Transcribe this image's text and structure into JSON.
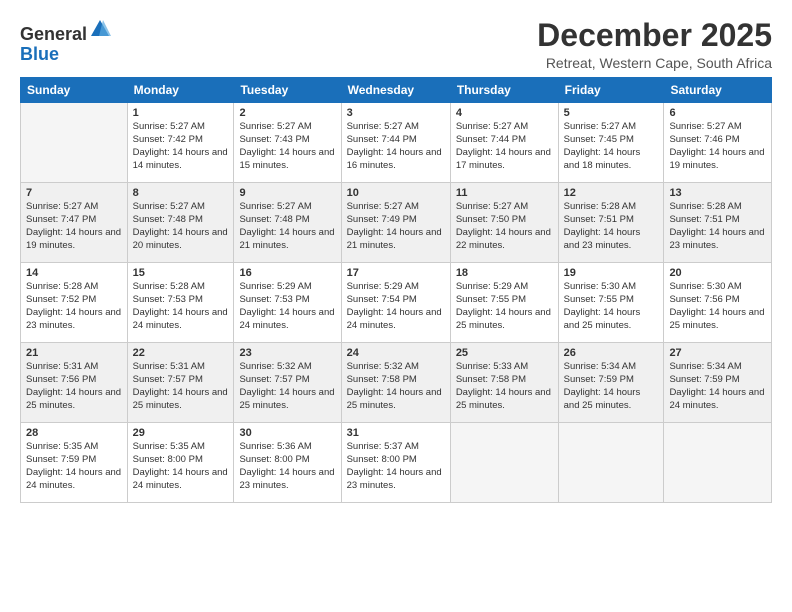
{
  "logo": {
    "line1": "General",
    "line2": "Blue"
  },
  "header": {
    "month": "December 2025",
    "location": "Retreat, Western Cape, South Africa"
  },
  "weekdays": [
    "Sunday",
    "Monday",
    "Tuesday",
    "Wednesday",
    "Thursday",
    "Friday",
    "Saturday"
  ],
  "weeks": [
    [
      {
        "day": "",
        "empty": true
      },
      {
        "day": "1",
        "sunrise": "5:27 AM",
        "sunset": "7:42 PM",
        "daylight": "14 hours and 14 minutes."
      },
      {
        "day": "2",
        "sunrise": "5:27 AM",
        "sunset": "7:43 PM",
        "daylight": "14 hours and 15 minutes."
      },
      {
        "day": "3",
        "sunrise": "5:27 AM",
        "sunset": "7:44 PM",
        "daylight": "14 hours and 16 minutes."
      },
      {
        "day": "4",
        "sunrise": "5:27 AM",
        "sunset": "7:44 PM",
        "daylight": "14 hours and 17 minutes."
      },
      {
        "day": "5",
        "sunrise": "5:27 AM",
        "sunset": "7:45 PM",
        "daylight": "14 hours and 18 minutes."
      },
      {
        "day": "6",
        "sunrise": "5:27 AM",
        "sunset": "7:46 PM",
        "daylight": "14 hours and 19 minutes."
      }
    ],
    [
      {
        "day": "7",
        "sunrise": "5:27 AM",
        "sunset": "7:47 PM",
        "daylight": "14 hours and 19 minutes."
      },
      {
        "day": "8",
        "sunrise": "5:27 AM",
        "sunset": "7:48 PM",
        "daylight": "14 hours and 20 minutes."
      },
      {
        "day": "9",
        "sunrise": "5:27 AM",
        "sunset": "7:48 PM",
        "daylight": "14 hours and 21 minutes."
      },
      {
        "day": "10",
        "sunrise": "5:27 AM",
        "sunset": "7:49 PM",
        "daylight": "14 hours and 21 minutes."
      },
      {
        "day": "11",
        "sunrise": "5:27 AM",
        "sunset": "7:50 PM",
        "daylight": "14 hours and 22 minutes."
      },
      {
        "day": "12",
        "sunrise": "5:28 AM",
        "sunset": "7:51 PM",
        "daylight": "14 hours and 23 minutes."
      },
      {
        "day": "13",
        "sunrise": "5:28 AM",
        "sunset": "7:51 PM",
        "daylight": "14 hours and 23 minutes."
      }
    ],
    [
      {
        "day": "14",
        "sunrise": "5:28 AM",
        "sunset": "7:52 PM",
        "daylight": "14 hours and 23 minutes."
      },
      {
        "day": "15",
        "sunrise": "5:28 AM",
        "sunset": "7:53 PM",
        "daylight": "14 hours and 24 minutes."
      },
      {
        "day": "16",
        "sunrise": "5:29 AM",
        "sunset": "7:53 PM",
        "daylight": "14 hours and 24 minutes."
      },
      {
        "day": "17",
        "sunrise": "5:29 AM",
        "sunset": "7:54 PM",
        "daylight": "14 hours and 24 minutes."
      },
      {
        "day": "18",
        "sunrise": "5:29 AM",
        "sunset": "7:55 PM",
        "daylight": "14 hours and 25 minutes."
      },
      {
        "day": "19",
        "sunrise": "5:30 AM",
        "sunset": "7:55 PM",
        "daylight": "14 hours and 25 minutes."
      },
      {
        "day": "20",
        "sunrise": "5:30 AM",
        "sunset": "7:56 PM",
        "daylight": "14 hours and 25 minutes."
      }
    ],
    [
      {
        "day": "21",
        "sunrise": "5:31 AM",
        "sunset": "7:56 PM",
        "daylight": "14 hours and 25 minutes."
      },
      {
        "day": "22",
        "sunrise": "5:31 AM",
        "sunset": "7:57 PM",
        "daylight": "14 hours and 25 minutes."
      },
      {
        "day": "23",
        "sunrise": "5:32 AM",
        "sunset": "7:57 PM",
        "daylight": "14 hours and 25 minutes."
      },
      {
        "day": "24",
        "sunrise": "5:32 AM",
        "sunset": "7:58 PM",
        "daylight": "14 hours and 25 minutes."
      },
      {
        "day": "25",
        "sunrise": "5:33 AM",
        "sunset": "7:58 PM",
        "daylight": "14 hours and 25 minutes."
      },
      {
        "day": "26",
        "sunrise": "5:34 AM",
        "sunset": "7:59 PM",
        "daylight": "14 hours and 25 minutes."
      },
      {
        "day": "27",
        "sunrise": "5:34 AM",
        "sunset": "7:59 PM",
        "daylight": "14 hours and 24 minutes."
      }
    ],
    [
      {
        "day": "28",
        "sunrise": "5:35 AM",
        "sunset": "7:59 PM",
        "daylight": "14 hours and 24 minutes."
      },
      {
        "day": "29",
        "sunrise": "5:35 AM",
        "sunset": "8:00 PM",
        "daylight": "14 hours and 24 minutes."
      },
      {
        "day": "30",
        "sunrise": "5:36 AM",
        "sunset": "8:00 PM",
        "daylight": "14 hours and 23 minutes."
      },
      {
        "day": "31",
        "sunrise": "5:37 AM",
        "sunset": "8:00 PM",
        "daylight": "14 hours and 23 minutes."
      },
      {
        "day": "",
        "empty": true
      },
      {
        "day": "",
        "empty": true
      },
      {
        "day": "",
        "empty": true
      }
    ]
  ]
}
